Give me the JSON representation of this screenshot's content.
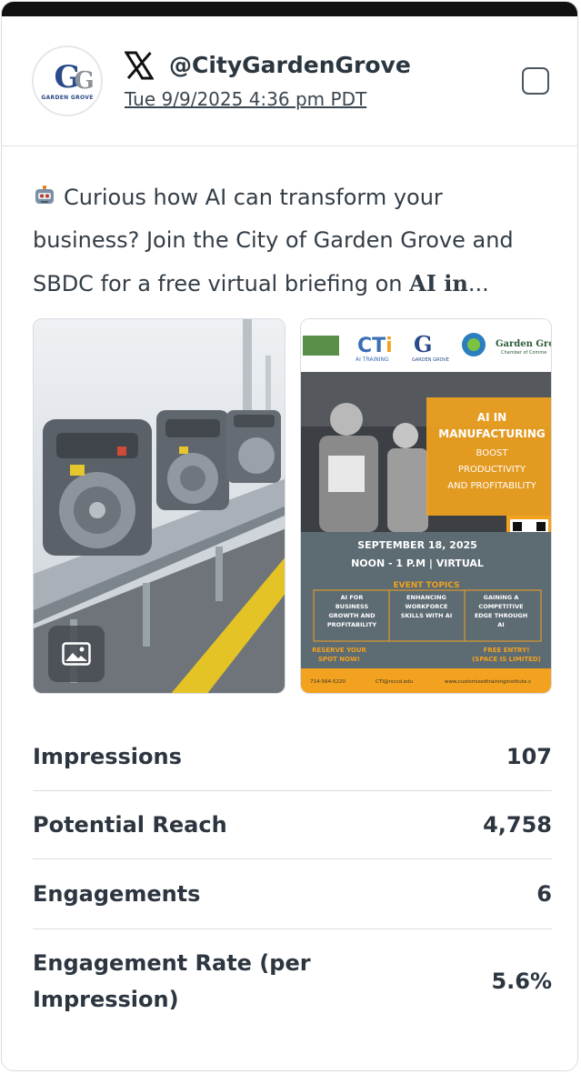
{
  "post": {
    "platform_icon": "x-logo-icon",
    "handle": "@CityGardenGrove",
    "timestamp": "Tue 9/9/2025 4:36 pm PDT",
    "avatar": {
      "logo_text": "G",
      "logo_sub": "GARDEN GROVE"
    },
    "text_intro": "Curious how AI can transform your business? Join the City of Garden Grove and SBDC for a free virtual briefing on ",
    "text_bold": "AI in",
    "text_ellipsis": "...",
    "emoji": "robot-icon"
  },
  "poster": {
    "logos": [
      "CTi",
      "AI TRAINING",
      "GARDEN GROVE",
      "Garden Gro",
      "Chamber of Comme"
    ],
    "headline1": "AI IN",
    "headline2": "MANUFACTURING",
    "sub1": "BOOST",
    "sub2": "PRODUCTIVITY",
    "sub3": "AND PROFITABILITY",
    "date": "SEPTEMBER 18, 2025",
    "time": "NOON - 1 P.M | VIRTUAL",
    "topics_title": "EVENT TOPICS",
    "topics": [
      "AI FOR BUSINESS GROWTH AND PROFITABILITY",
      "ENHANCING WORKFORCE SKILLS WITH AI",
      "GAINING A COMPETITIVE EDGE THROUGH AI"
    ],
    "cta_left": "RESERVE YOUR SPOT NOW!",
    "cta_right": "FREE ENTRY! (SPACE IS LIMITED)",
    "footer": [
      "714-564-5220",
      "CTI@rsccd.edu",
      "www.customizedtraininginstitute.c"
    ]
  },
  "stats": [
    {
      "label": "Impressions",
      "value": "107"
    },
    {
      "label": "Potential Reach",
      "value": "4,758"
    },
    {
      "label": "Engagements",
      "value": "6"
    },
    {
      "label": "Engagement Rate (per Impression)",
      "value": "5.6%"
    }
  ],
  "colors": {
    "accent_orange": "#f2a21e",
    "poster_slate": "#5d6b73",
    "text_dark": "#2d3640"
  }
}
